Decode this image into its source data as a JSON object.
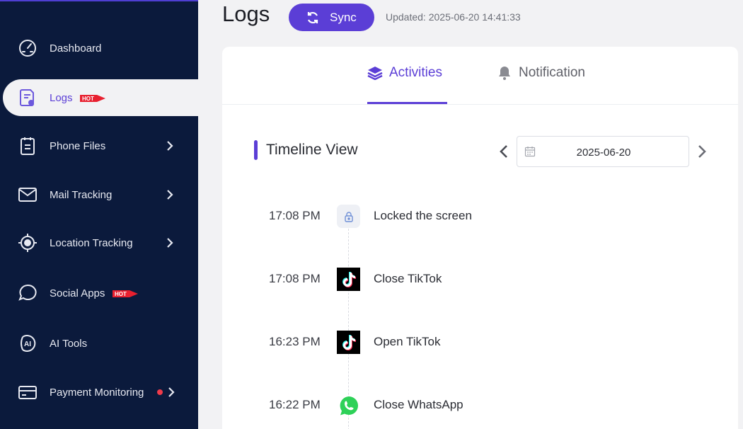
{
  "sidebar": {
    "items": [
      {
        "label": "Dashboard",
        "icon": "gauge-icon"
      },
      {
        "label": "Logs",
        "icon": "document-icon",
        "badge": "HOT",
        "active": true
      },
      {
        "label": "Phone Files",
        "icon": "clipboard-icon"
      },
      {
        "label": "Mail Tracking",
        "icon": "mail-icon"
      },
      {
        "label": "Location Tracking",
        "icon": "crosshair-icon"
      },
      {
        "label": "Social Apps",
        "icon": "chat-bubble-icon",
        "badge": "HOT"
      },
      {
        "label": "AI Tools",
        "icon": "ai-icon"
      },
      {
        "label": "Payment Monitoring",
        "icon": "credit-card-icon"
      }
    ]
  },
  "header": {
    "title": "Logs",
    "sync_label": "Sync",
    "updated": "Updated: 2025-06-20 14:41:33"
  },
  "tabs": [
    {
      "label": "Activities",
      "icon": "layers-icon",
      "active": true
    },
    {
      "label": "Notification",
      "icon": "bell-icon"
    }
  ],
  "timeline": {
    "title": "Timeline View",
    "date": "2025-06-20",
    "events": [
      {
        "time": "17:08 PM",
        "text": "Locked the screen",
        "icon": "lock-icon"
      },
      {
        "time": "17:08 PM",
        "text": "Close TikTok",
        "icon": "tiktok-icon"
      },
      {
        "time": "16:23 PM",
        "text": "Open TikTok",
        "icon": "tiktok-icon"
      },
      {
        "time": "16:22 PM",
        "text": "Close WhatsApp",
        "icon": "whatsapp-icon"
      }
    ]
  },
  "colors": {
    "sidebar_bg": "#0b1a3c",
    "accent": "#5b3ed6",
    "hot_badge": "#e8202f",
    "dot": "#f03b4a",
    "whatsapp": "#2ed158"
  }
}
